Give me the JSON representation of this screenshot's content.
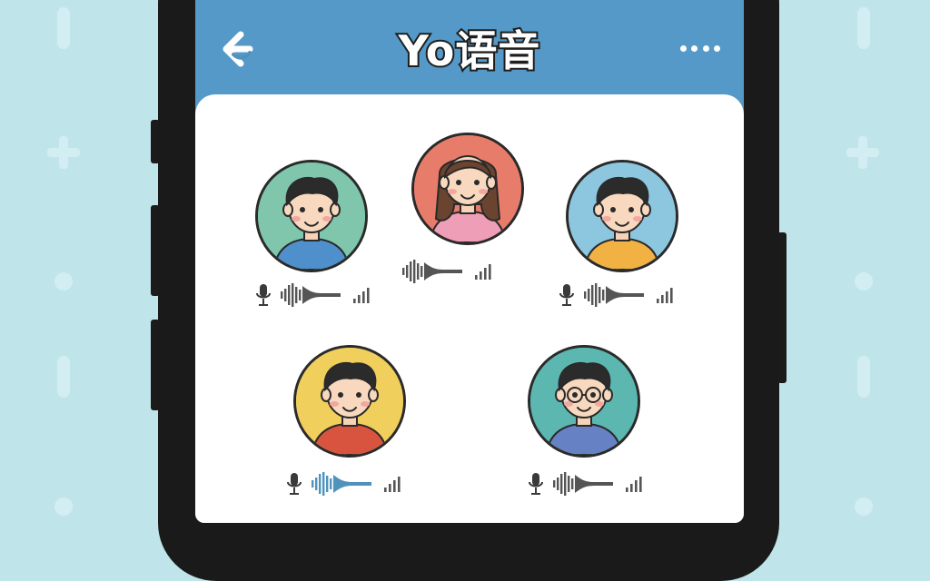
{
  "header": {
    "title": "Yo语音",
    "back_icon": "back-arrow-icon",
    "more_icon": "more-dots-icon"
  },
  "colors": {
    "header_bg": "#5499c7",
    "page_bg": "#bfe4ea",
    "active_wave": "#4f93bd",
    "idle_wave": "#555555"
  },
  "participants": [
    {
      "id": "p1",
      "avatar_bg": "#7fc6ad",
      "shirt": "#4f8fcb",
      "hair": "#2b2b2b",
      "show_mic": true,
      "speaking": false
    },
    {
      "id": "p2",
      "avatar_bg": "#e87c6a",
      "shirt": "#ee9eb6",
      "hair": "#6b4430",
      "show_mic": false,
      "speaking": false
    },
    {
      "id": "p3",
      "avatar_bg": "#8dc6df",
      "shirt": "#f2b143",
      "hair": "#2b2b2b",
      "show_mic": true,
      "speaking": false
    },
    {
      "id": "p4",
      "avatar_bg": "#f0cf5c",
      "shirt": "#d9543f",
      "hair": "#2b2b2b",
      "show_mic": true,
      "speaking": true
    },
    {
      "id": "p5",
      "avatar_bg": "#5bb7b0",
      "shirt": "#6782c4",
      "hair": "#2b2b2b",
      "show_mic": true,
      "speaking": false,
      "glasses": true
    }
  ]
}
